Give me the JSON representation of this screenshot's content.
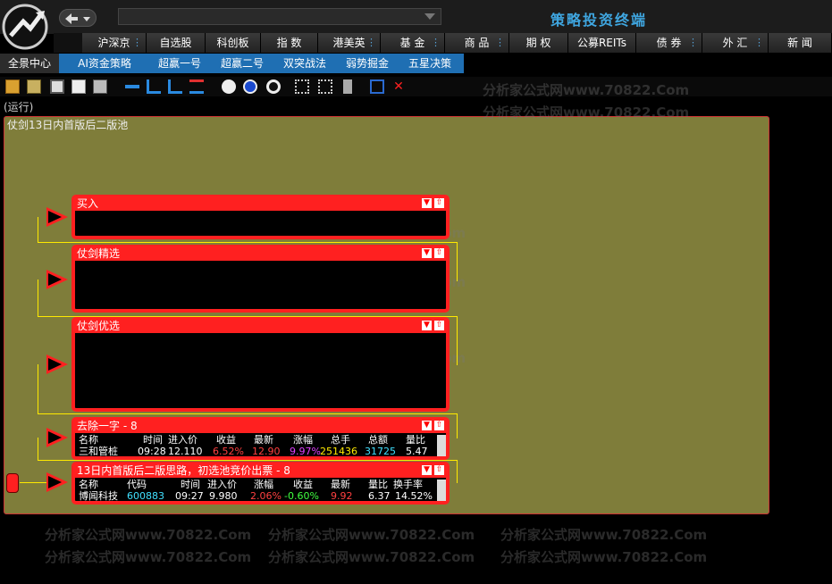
{
  "header": {
    "title": "策略投资终端",
    "search_placeholder": ""
  },
  "menu": [
    {
      "label": "沪深京",
      "dots": true
    },
    {
      "label": "自选股",
      "dots": false
    },
    {
      "label": "科创板",
      "dots": false
    },
    {
      "label": "指 数",
      "dots": false
    },
    {
      "label": "港美英",
      "dots": true
    },
    {
      "label": "基 金",
      "dots": true
    },
    {
      "label": "商 品",
      "dots": true
    },
    {
      "label": "期 权",
      "dots": false
    },
    {
      "label": "公募REITs",
      "dots": false
    },
    {
      "label": "债 券",
      "dots": true
    },
    {
      "label": "外 汇",
      "dots": true
    },
    {
      "label": "新 闻",
      "dots": false
    }
  ],
  "subtabs": [
    "全景中心",
    "AI资金策略",
    "超赢一号",
    "超赢二号",
    "双突战法",
    "弱势掘金",
    "五星决策"
  ],
  "status": "(运行)",
  "canvas_title": "仗剑13日内首版后二版池",
  "nodes": {
    "buy": {
      "title": "买入"
    },
    "select": {
      "title": "仗剑精选"
    },
    "prefer": {
      "title": "仗剑优选"
    },
    "remove": {
      "title": "去除一字 - 8",
      "columns": [
        "名称",
        "时间",
        "进入价",
        "收益",
        "最新",
        "涨幅",
        "总手",
        "总额",
        "量比"
      ],
      "row": {
        "name": "三和管桩",
        "time": "09:28",
        "entry": "12.110",
        "gain": "6.52%",
        "latest": "12.90",
        "change": "9.97%",
        "volume": "251436",
        "amount": "31725",
        "ratio": "5.47"
      }
    },
    "pool": {
      "title": "13日内首版后二版思路，初选池竞价出票 - 8",
      "columns": [
        "名称",
        "代码",
        "时间",
        "进入价",
        "涨幅",
        "收益",
        "最新",
        "量比",
        "换手率"
      ],
      "row": {
        "name": "博闻科技",
        "code": "600883",
        "time": "09:27",
        "entry": "9.980",
        "change": "2.06%",
        "gain": "-0.60%",
        "latest": "9.92",
        "ratio": "6.37",
        "turnover": "14.52%"
      }
    }
  },
  "watermark": "分析家公式网www.70822.Com",
  "colors": {
    "accent": "#1f6fb3",
    "node": "#ff2020",
    "wire": "#ffea00",
    "canvas": "#7f7d3a",
    "title": "#3fa6e0"
  }
}
